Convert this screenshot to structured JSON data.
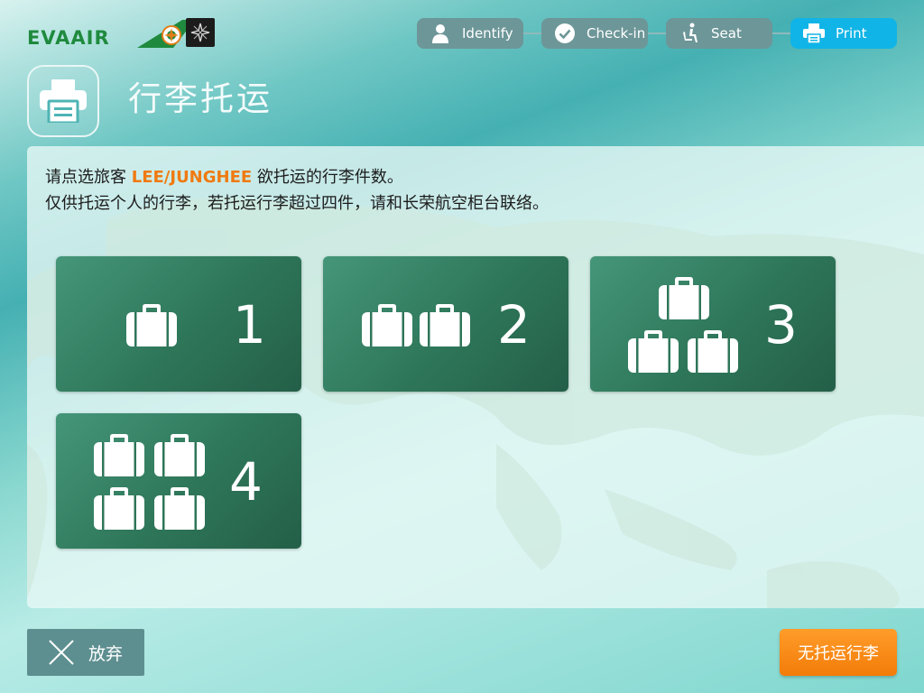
{
  "header": {
    "logo_text": "EVAAIR",
    "steps": [
      {
        "label": "Identify",
        "icon": "person-icon"
      },
      {
        "label": "Check-in",
        "icon": "check-circle-icon"
      },
      {
        "label": "Seat",
        "icon": "seat-icon"
      },
      {
        "label": "Print",
        "icon": "printer-icon",
        "active": true
      }
    ],
    "page_icon": "printer-icon",
    "page_title": "行李托运"
  },
  "instructions": {
    "line1_prefix": "请点选旅客 ",
    "passenger_name": "LEE/JUNGHEE",
    "line1_suffix": " 欲托运的行李件数。",
    "line2": "仅供托运个人的行李，若托运行李超过四件，请和长荣航空柜台联络。"
  },
  "bag_options": [
    {
      "count": "1",
      "icon": "suitcase-icon"
    },
    {
      "count": "2",
      "icon": "suitcase-icon"
    },
    {
      "count": "3",
      "icon": "suitcase-icon"
    },
    {
      "count": "4",
      "icon": "suitcase-icon"
    }
  ],
  "footer": {
    "abandon_label": "放弃",
    "no_bag_label": "无托运行李"
  },
  "colors": {
    "accent_orange": "#f07a10",
    "active_step": "#11b4e6",
    "inactive_step": "#6d9698",
    "bag_button": "#2e7659",
    "brand_green": "#1f8a3e"
  }
}
